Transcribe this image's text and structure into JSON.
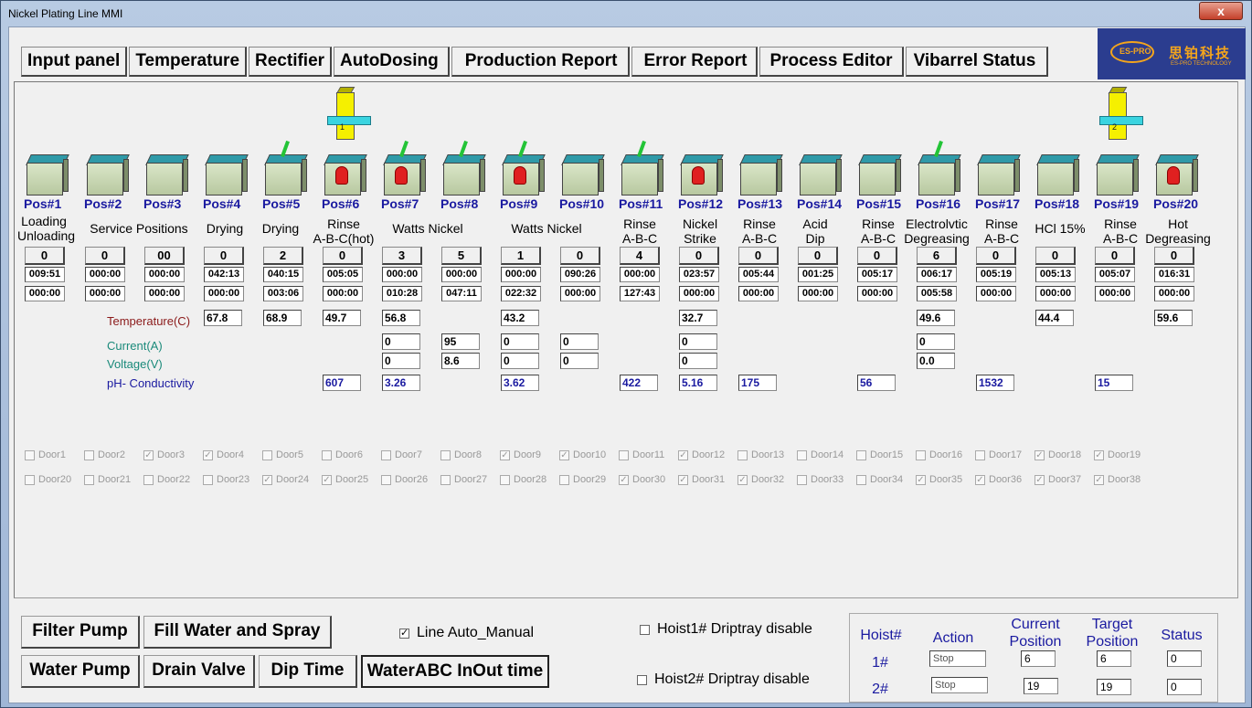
{
  "window": {
    "title": "Nickel Plating Line MMI",
    "close": "x"
  },
  "tabs": [
    "Input panel",
    "Temperature",
    "Rectifier",
    "AutoDosing",
    "Production Report",
    "Error Report",
    "Process Editor",
    "Vibarrel Status"
  ],
  "logo": {
    "cn": "思铂科技",
    "en": "ES-PRO TECHNOLOGY",
    "mark": "ES-PRO"
  },
  "hoists": [
    {
      "num": "1"
    },
    {
      "num": "2"
    }
  ],
  "positions": [
    {
      "label": "Pos#1",
      "count": "0",
      "t1": "009:51",
      "t2": "000:00",
      "tank": "plain"
    },
    {
      "label": "Pos#2",
      "count": "0",
      "t1": "000:00",
      "t2": "000:00",
      "tank": "plain"
    },
    {
      "label": "Pos#3",
      "count": "00",
      "t1": "000:00",
      "t2": "000:00",
      "tank": "plain"
    },
    {
      "label": "Pos#4",
      "count": "0",
      "t1": "042:13",
      "t2": "000:00",
      "tank": "plain"
    },
    {
      "label": "Pos#5",
      "count": "2",
      "t1": "040:15",
      "t2": "003:06",
      "tank": "pole"
    },
    {
      "label": "Pos#6",
      "count": "0",
      "t1": "005:05",
      "t2": "000:00",
      "tank": "bell"
    },
    {
      "label": "Pos#7",
      "count": "3",
      "t1": "000:00",
      "t2": "010:28",
      "tank": "polebell"
    },
    {
      "label": "Pos#8",
      "count": "5",
      "t1": "000:00",
      "t2": "047:11",
      "tank": "pole"
    },
    {
      "label": "Pos#9",
      "count": "1",
      "t1": "000:00",
      "t2": "022:32",
      "tank": "polebell"
    },
    {
      "label": "Pos#10",
      "count": "0",
      "t1": "090:26",
      "t2": "000:00",
      "tank": "plain"
    },
    {
      "label": "Pos#11",
      "count": "4",
      "t1": "000:00",
      "t2": "127:43",
      "tank": "pole"
    },
    {
      "label": "Pos#12",
      "count": "0",
      "t1": "023:57",
      "t2": "000:00",
      "tank": "bell"
    },
    {
      "label": "Pos#13",
      "count": "0",
      "t1": "005:44",
      "t2": "000:00",
      "tank": "plain"
    },
    {
      "label": "Pos#14",
      "count": "0",
      "t1": "001:25",
      "t2": "000:00",
      "tank": "plain"
    },
    {
      "label": "Pos#15",
      "count": "0",
      "t1": "005:17",
      "t2": "000:00",
      "tank": "plain"
    },
    {
      "label": "Pos#16",
      "count": "6",
      "t1": "006:17",
      "t2": "005:58",
      "tank": "pole"
    },
    {
      "label": "Pos#17",
      "count": "0",
      "t1": "005:19",
      "t2": "000:00",
      "tank": "plain"
    },
    {
      "label": "Pos#18",
      "count": "0",
      "t1": "005:13",
      "t2": "000:00",
      "tank": "plain"
    },
    {
      "label": "Pos#19",
      "count": "0",
      "t1": "005:07",
      "t2": "000:00",
      "tank": "plain"
    },
    {
      "label": "Pos#20",
      "count": "0",
      "t1": "016:31",
      "t2": "000:00",
      "tank": "bell"
    }
  ],
  "processes": {
    "loading": "Loading\nUnloading",
    "service": "Service Positions",
    "drying": "Drying",
    "rinse_hot": "Rinse\nA-B-C(hot)",
    "watts": "Watts Nickel",
    "rinse": "Rinse\nA-B-C",
    "strike": "Nickel\nStrike",
    "acid": "Acid\nDip",
    "electro": "Electrolvtic\nDegreasing",
    "hcl": "HCl 15%",
    "hot_deg": "Hot\nDegreasing"
  },
  "row_labels": {
    "temp": "Temperature(C)",
    "current": "Current(A)",
    "voltage": "Voltage(V)",
    "ph": "pH- Conductivity"
  },
  "readings": {
    "temp": {
      "4": "67.8",
      "5": "68.9",
      "6": "49.7",
      "7": "56.8",
      "9": "43.2",
      "12": "32.7",
      "16": "49.6",
      "18": "44.4",
      "20": "59.6"
    },
    "current": {
      "7": "0",
      "8": "95",
      "9": "0",
      "10": "0",
      "12": "0",
      "16": "0"
    },
    "voltage": {
      "7": "0",
      "8": "8.6",
      "9": "0",
      "10": "0",
      "12": "0",
      "16": "0.0"
    },
    "ph": {
      "6": "607",
      "7": "3.26",
      "9": "3.62",
      "11": "422",
      "12": "5.16",
      "13": "175",
      "15": "56",
      "17": "1532",
      "19": "15"
    }
  },
  "doors_row1": [
    {
      "label": "Door1",
      "checked": false
    },
    {
      "label": "Door2",
      "checked": false
    },
    {
      "label": "Door3",
      "checked": true
    },
    {
      "label": "Door4",
      "checked": true
    },
    {
      "label": "Door5",
      "checked": false
    },
    {
      "label": "Door6",
      "checked": false
    },
    {
      "label": "Door7",
      "checked": false
    },
    {
      "label": "Door8",
      "checked": false
    },
    {
      "label": "Door9",
      "checked": true
    },
    {
      "label": "Door10",
      "checked": true
    },
    {
      "label": "Door11",
      "checked": false
    },
    {
      "label": "Door12",
      "checked": true
    },
    {
      "label": "Door13",
      "checked": false
    },
    {
      "label": "Door14",
      "checked": false
    },
    {
      "label": "Door15",
      "checked": false
    },
    {
      "label": "Door16",
      "checked": false
    },
    {
      "label": "Door17",
      "checked": false
    },
    {
      "label": "Door18",
      "checked": true
    },
    {
      "label": "Door19",
      "checked": true
    }
  ],
  "doors_row2": [
    {
      "label": "Door20",
      "checked": false
    },
    {
      "label": "Door21",
      "checked": false
    },
    {
      "label": "Door22",
      "checked": false
    },
    {
      "label": "Door23",
      "checked": false
    },
    {
      "label": "Door24",
      "checked": true
    },
    {
      "label": "Door25",
      "checked": true
    },
    {
      "label": "Door26",
      "checked": false
    },
    {
      "label": "Door27",
      "checked": false
    },
    {
      "label": "Door28",
      "checked": false
    },
    {
      "label": "Door29",
      "checked": false
    },
    {
      "label": "Door30",
      "checked": true
    },
    {
      "label": "Door31",
      "checked": true
    },
    {
      "label": "Door32",
      "checked": true
    },
    {
      "label": "Door33",
      "checked": false
    },
    {
      "label": "Door34",
      "checked": false
    },
    {
      "label": "Door35",
      "checked": true
    },
    {
      "label": "Door36",
      "checked": true
    },
    {
      "label": "Door37",
      "checked": true
    },
    {
      "label": "Door38",
      "checked": true
    }
  ],
  "buttons": {
    "filter_pump": "Filter Pump",
    "fill_water": "Fill Water and Spray",
    "water_pump": "Water Pump",
    "drain_valve": "Drain Valve",
    "dip_time": "Dip Time",
    "waterabc": "WaterABC InOut time"
  },
  "checks": {
    "line_auto": "Line Auto_Manual",
    "hoist1_drip": "Hoist1# Driptray disable",
    "hoist2_drip": "Hoist2# Driptray disable"
  },
  "hoist_table": {
    "headers": {
      "hoist": "Hoist#",
      "action": "Action",
      "current": "Current\nPosition",
      "target": "Target\nPosition",
      "status": "Status"
    },
    "rows": [
      {
        "hoist": "1#",
        "action": "Stop",
        "current": "6",
        "target": "6",
        "status": "0"
      },
      {
        "hoist": "2#",
        "action": "Stop",
        "current": "19",
        "target": "19",
        "status": "0"
      }
    ]
  },
  "colors": {
    "temp_label": "#8b1a1a",
    "current_label": "#1a8a7a",
    "ph_label": "#1a1aa0",
    "pos_label": "#1a1aa0"
  }
}
